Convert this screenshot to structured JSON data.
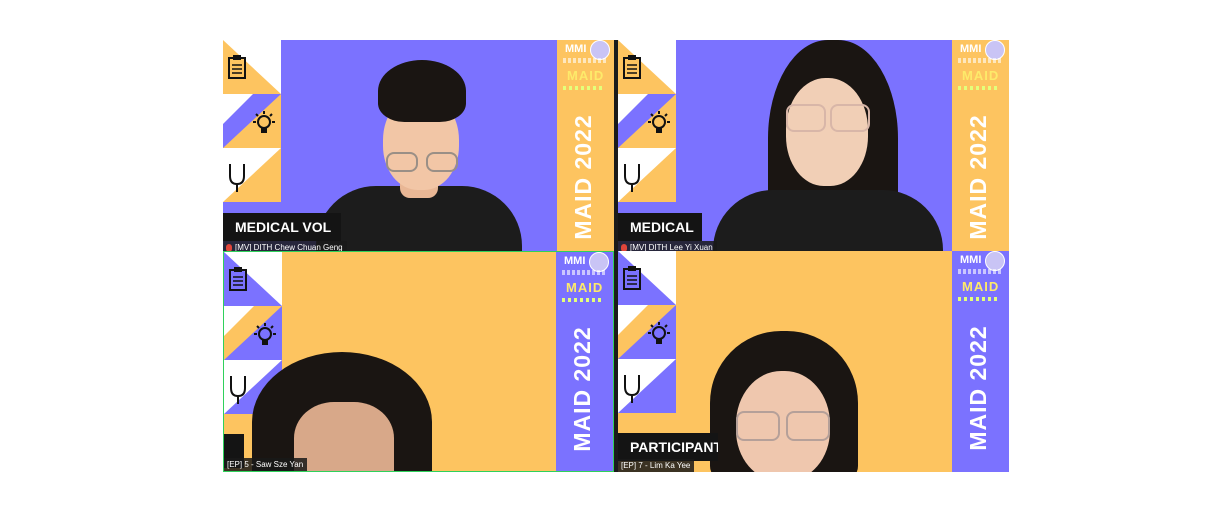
{
  "tiles": [
    {
      "id": "tile-1",
      "name": "[MV] DITH Chew Chuan Geng",
      "muted": true,
      "banner": "MEDICAL VOL",
      "side_text": "MAID 2022",
      "logo_mmi": "MMI",
      "logo_maid": "MAID"
    },
    {
      "id": "tile-2",
      "name": "[MV] DITH Lee Yi Xuan",
      "muted": true,
      "banner": "MEDICAL",
      "side_text": "MAID 2022",
      "logo_mmi": "MMI",
      "logo_maid": "MAID"
    },
    {
      "id": "tile-3",
      "name": "[EP] 5 - Saw Sze Yan",
      "muted": false,
      "banner": "",
      "side_text": "MAID 2022",
      "logo_mmi": "MMI",
      "logo_maid": "MAID"
    },
    {
      "id": "tile-4",
      "name": "[EP] 7 - Lim Ka Yee",
      "muted": false,
      "banner": "PARTICIPANT",
      "side_text": "MAID 2022",
      "logo_mmi": "MMI",
      "logo_maid": "MAID"
    }
  ],
  "icons": [
    "clipboard-icon",
    "lightbulb-icon",
    "stethoscope-icon",
    "mute-icon"
  ],
  "colors": {
    "purple": "#7b72ff",
    "yellow": "#fdc460",
    "active_speaker_border": "#2fd15b",
    "banner_bg": "#141414"
  }
}
